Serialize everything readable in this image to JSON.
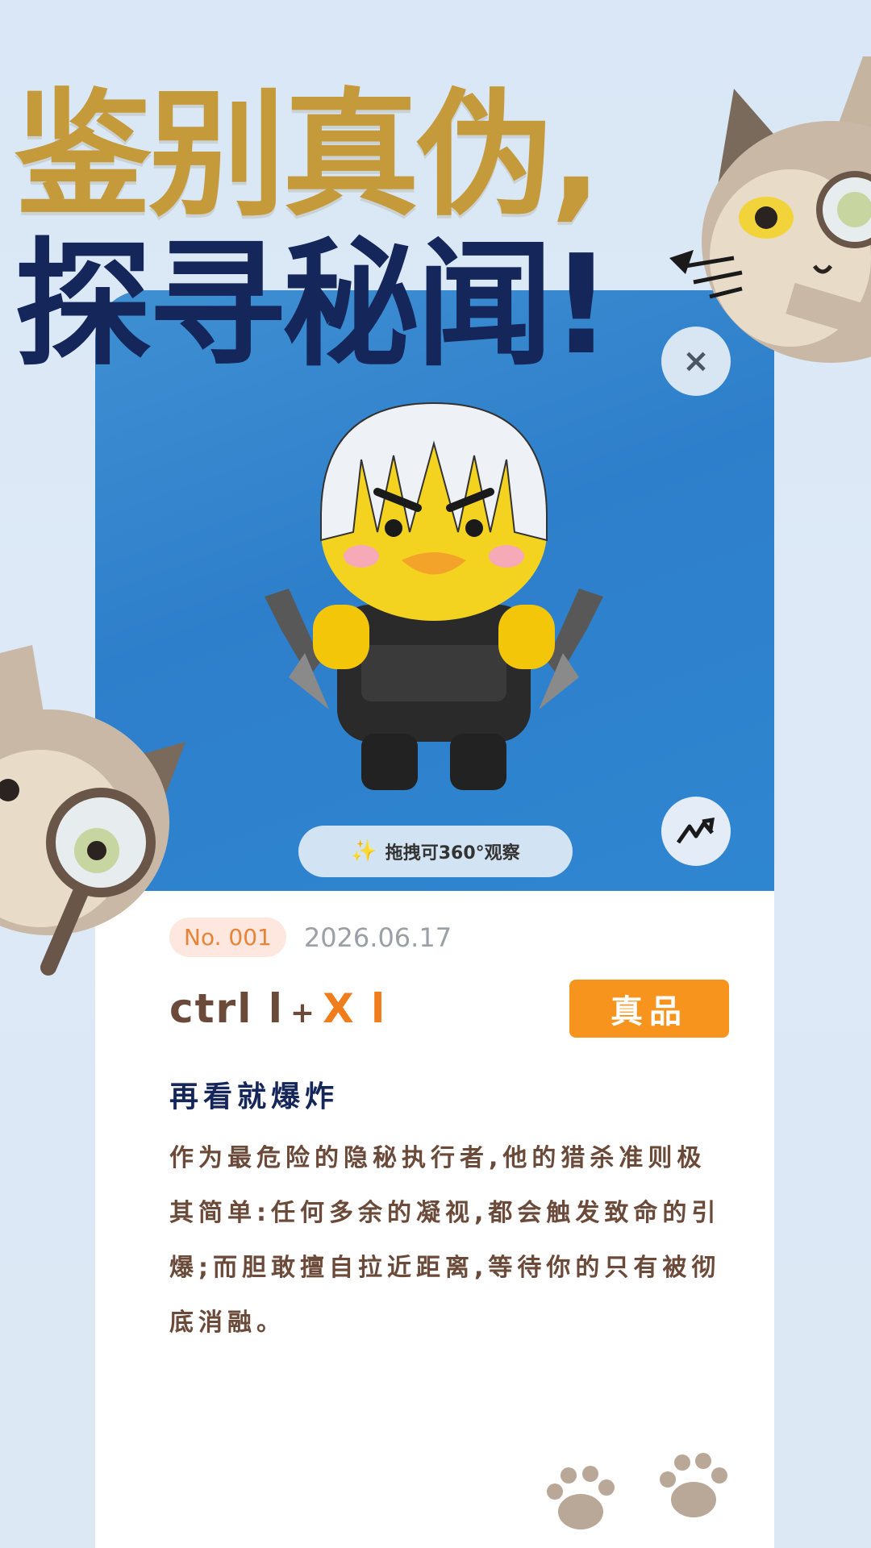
{
  "headline": {
    "line1": "鉴别真伪,",
    "line2": "探寻秘闻!"
  },
  "viewer": {
    "close_icon": "close-icon",
    "drag_hint": "拖拽可360°观察",
    "hint_icon": "sparkle-icon",
    "share_icon": "share-icon"
  },
  "item": {
    "number": "No. 001",
    "date": "2026.06.17",
    "name_part1": "ctrl l",
    "name_plus": "+",
    "name_part2": "X l",
    "status": "真品",
    "subtitle": "再看就爆炸",
    "description": "作为最危险的隐秘执行者,他的猎杀准则极其简单:任何多余的凝视,都会触发致命的引爆;而胆敢擅自拉近距离,等待你的只有被彻底消融。"
  },
  "colors": {
    "gold": "#c49a3a",
    "navy": "#15265a",
    "orange": "#f7941d",
    "brown": "#6b4a3a",
    "blue": "#2e7fcb"
  }
}
